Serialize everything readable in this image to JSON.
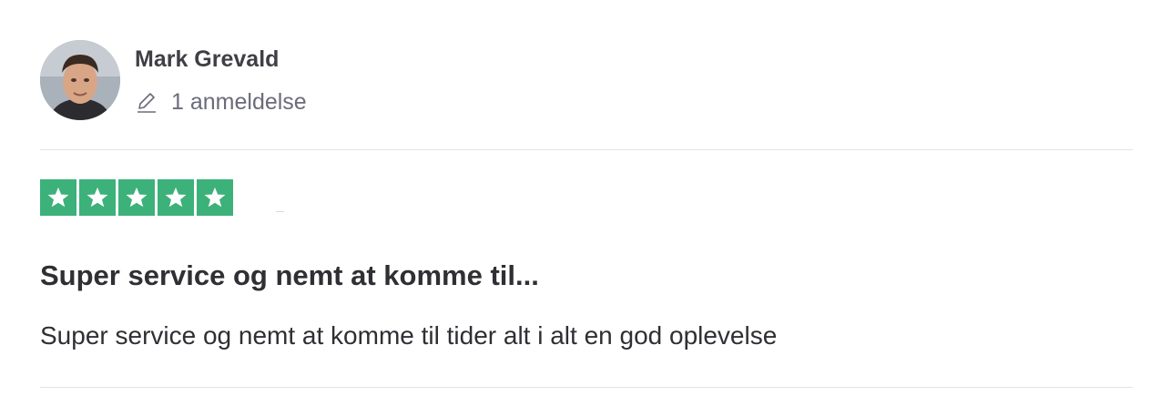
{
  "reviewer": {
    "name": "Mark Grevald",
    "review_count": "1 anmeldelse",
    "avatar_icon": "avatar-photo",
    "count_icon": "pencil-icon"
  },
  "rating": {
    "stars": 5,
    "max_stars": 5,
    "star_color": "#3cb17a"
  },
  "review": {
    "title": "Super service og nemt at komme til...",
    "body": "Super service og nemt at komme til tider alt i alt en god oplevelse"
  }
}
